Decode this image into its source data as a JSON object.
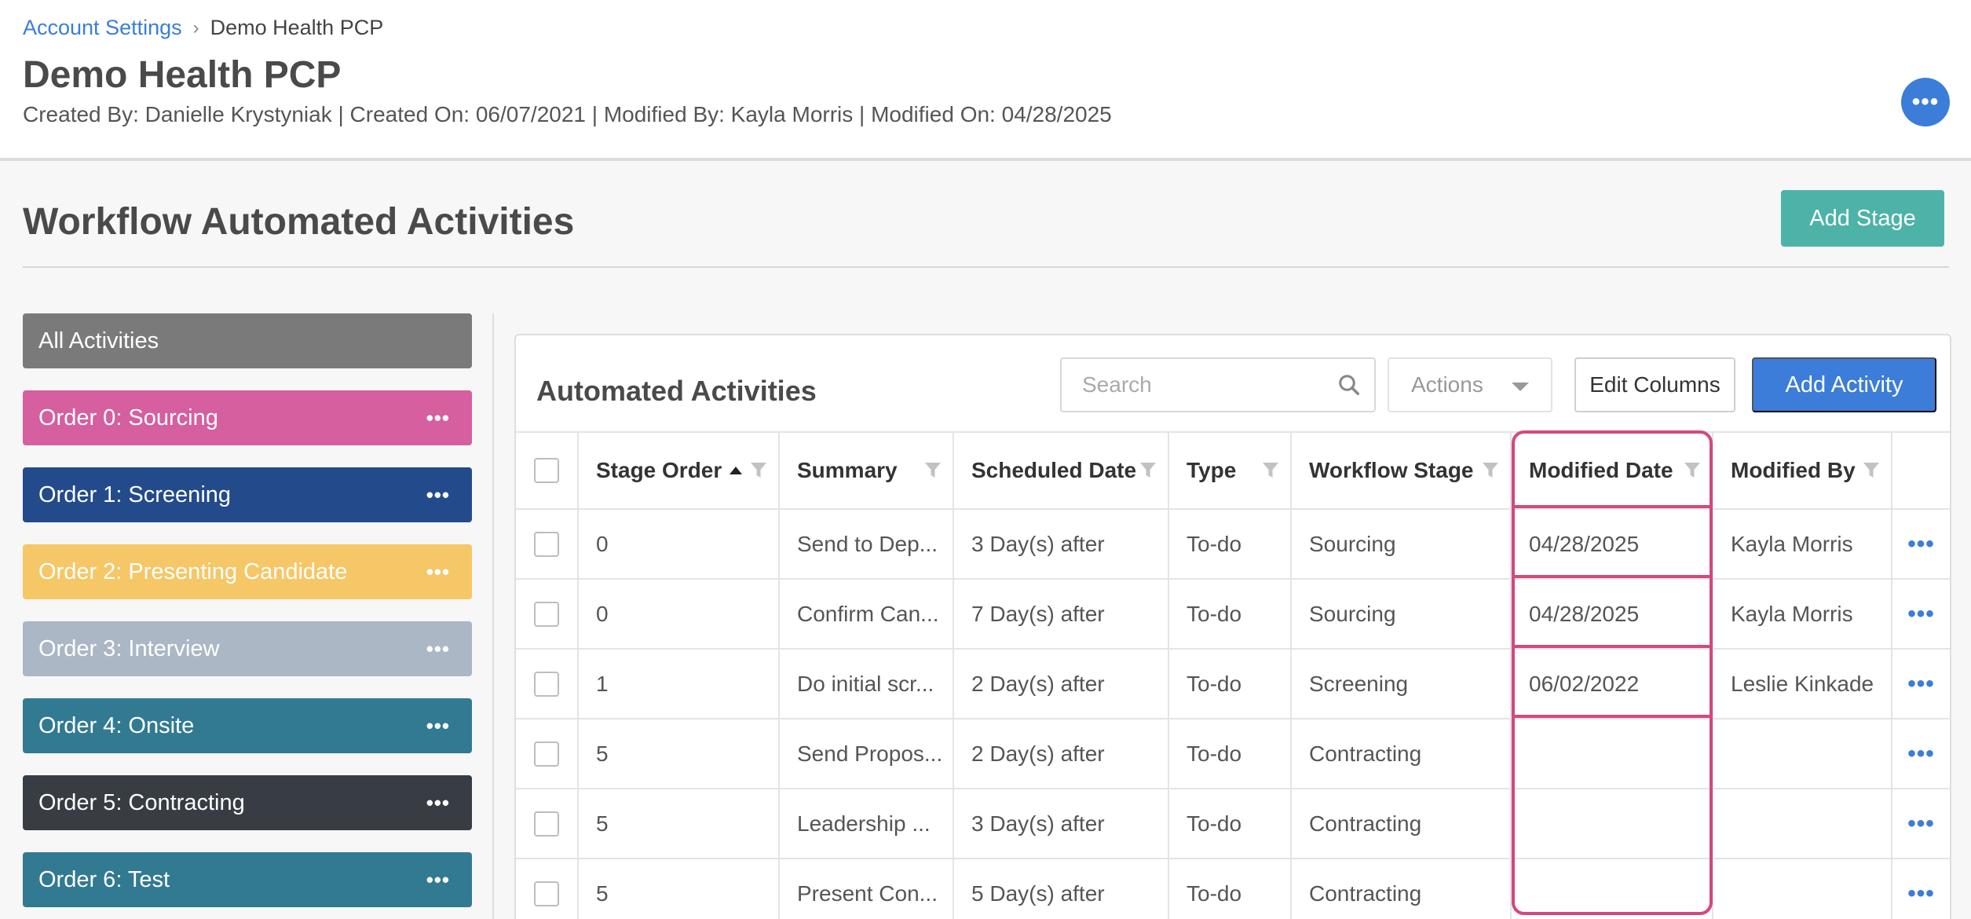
{
  "breadcrumb": {
    "parent": "Account Settings",
    "current": "Demo Health PCP"
  },
  "page": {
    "title": "Demo Health PCP",
    "meta": "Created By: Danielle Krystyniak | Created On: 06/07/2021 | Modified By: Kayla Morris | Modified On: 04/28/2025"
  },
  "section": {
    "title": "Workflow Automated Activities",
    "add_stage_label": "Add Stage"
  },
  "stages": [
    {
      "label": "All Activities",
      "color": "#7a7a7a",
      "menu": false
    },
    {
      "label": "Order 0: Sourcing",
      "color": "#d55f9f",
      "menu": true
    },
    {
      "label": "Order 1: Screening",
      "color": "#234b8c",
      "menu": true
    },
    {
      "label": "Order 2: Presenting Candidate",
      "color": "#f5c767",
      "menu": true
    },
    {
      "label": "Order 3: Interview",
      "color": "#abb7c4",
      "menu": true
    },
    {
      "label": "Order 4: Onsite",
      "color": "#327a91",
      "menu": true
    },
    {
      "label": "Order 5: Contracting",
      "color": "#373d43",
      "menu": true
    },
    {
      "label": "Order 6: Test",
      "color": "#327a91",
      "menu": true
    }
  ],
  "panel": {
    "title": "Automated Activities",
    "search_placeholder": "Search",
    "actions_label": "Actions",
    "edit_columns_label": "Edit Columns",
    "add_activity_label": "Add Activity"
  },
  "table": {
    "columns": [
      "Stage Order",
      "Summary",
      "Scheduled Date",
      "Type",
      "Workflow Stage",
      "Modified Date",
      "Modified By"
    ],
    "sorted_column": "Stage Order",
    "rows": [
      {
        "stage_order": "0",
        "summary": "Send to Dep...",
        "scheduled": "3 Day(s) after",
        "type": "To-do",
        "stage": "Sourcing",
        "modified_date": "04/28/2025",
        "modified_by": "Kayla Morris"
      },
      {
        "stage_order": "0",
        "summary": "Confirm Can...",
        "scheduled": "7 Day(s) after",
        "type": "To-do",
        "stage": "Sourcing",
        "modified_date": "04/28/2025",
        "modified_by": "Kayla Morris"
      },
      {
        "stage_order": "1",
        "summary": "Do initial scr...",
        "scheduled": "2 Day(s) after",
        "type": "To-do",
        "stage": "Screening",
        "modified_date": "06/02/2022",
        "modified_by": "Leslie Kinkade"
      },
      {
        "stage_order": "5",
        "summary": "Send Propos...",
        "scheduled": "2 Day(s) after",
        "type": "To-do",
        "stage": "Contracting",
        "modified_date": "",
        "modified_by": ""
      },
      {
        "stage_order": "5",
        "summary": "Leadership ...",
        "scheduled": "3 Day(s) after",
        "type": "To-do",
        "stage": "Contracting",
        "modified_date": "",
        "modified_by": ""
      },
      {
        "stage_order": "5",
        "summary": "Present Con...",
        "scheduled": "5 Day(s) after",
        "type": "To-do",
        "stage": "Contracting",
        "modified_date": "",
        "modified_by": ""
      }
    ]
  },
  "highlight": {
    "column": "Modified Date",
    "color": "#d4487f"
  }
}
